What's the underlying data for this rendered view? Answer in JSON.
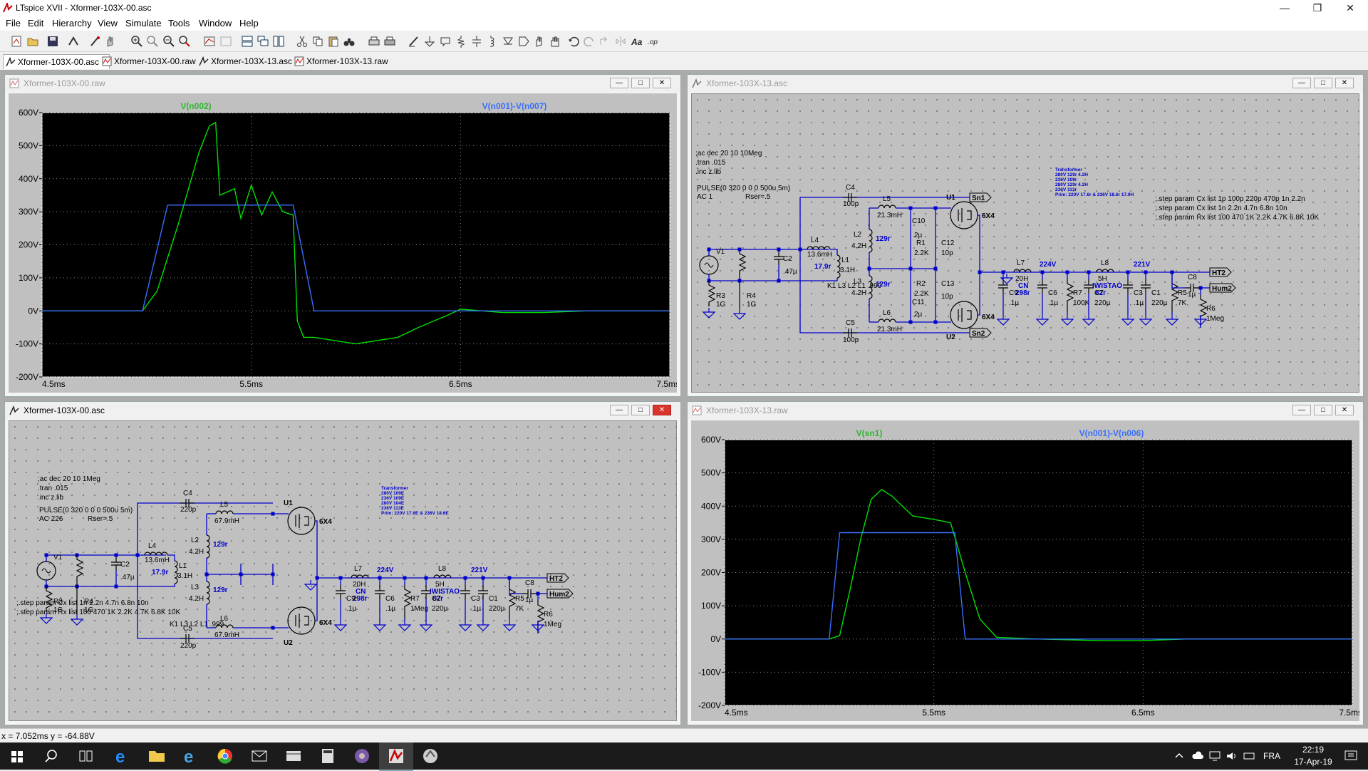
{
  "window": {
    "title": "LTspice XVII - Xformer-103X-00.asc"
  },
  "menu": [
    "File",
    "Edit",
    "Hierarchy",
    "View",
    "Simulate",
    "Tools",
    "Window",
    "Help"
  ],
  "tabs": [
    {
      "label": "Xformer-103X-00.asc",
      "active": true
    },
    {
      "label": "Xformer-103X-00.raw",
      "active": false
    },
    {
      "label": "Xformer-103X-13.asc",
      "active": false
    },
    {
      "label": "Xformer-103X-13.raw",
      "active": false
    }
  ],
  "windows": {
    "tl": {
      "title": "Xformer-103X-00.raw"
    },
    "tr": {
      "title": "Xformer-103X-13.asc"
    },
    "bl": {
      "title": "Xformer-103X-00.asc"
    },
    "br": {
      "title": "Xformer-103X-13.raw"
    }
  },
  "plot_tl": {
    "trace1": "V(n002)",
    "trace2": "V(n001)-V(n007)",
    "color1": "#00e000",
    "color2": "#3a6fff",
    "yticks": [
      "600V",
      "500V",
      "400V",
      "300V",
      "200V",
      "100V",
      "0V",
      "-100V",
      "-200V"
    ],
    "xticks": [
      "4.5ms",
      "5.5ms",
      "6.5ms",
      "7.5ms"
    ]
  },
  "plot_br": {
    "trace1": "V(sn1)",
    "trace2": "V(n001)-V(n006)",
    "yticks": [
      "600V",
      "500V",
      "400V",
      "300V",
      "200V",
      "100V",
      "0V",
      "-100V",
      "-200V"
    ],
    "xticks": [
      "4.5ms",
      "5.5ms",
      "6.5ms",
      "7.5ms"
    ]
  },
  "chart_data": [
    {
      "type": "line",
      "xlabel": "",
      "ylabel": "",
      "xlim": [
        4.5,
        7.5
      ],
      "ylim": [
        -200,
        600
      ],
      "x_unit": "ms",
      "y_unit": "V",
      "grid": true,
      "series": [
        {
          "name": "V(n002)",
          "x": [
            4.5,
            4.98,
            5.05,
            5.15,
            5.25,
            5.3,
            5.33,
            5.35,
            5.42,
            5.45,
            5.5,
            5.55,
            5.6,
            5.65,
            5.7,
            5.72,
            5.75,
            5.8,
            6.0,
            6.2,
            6.3,
            6.45,
            6.5,
            6.7,
            6.9,
            7.1,
            7.5
          ],
          "y": [
            0,
            0,
            60,
            260,
            480,
            560,
            570,
            350,
            370,
            280,
            380,
            290,
            360,
            300,
            290,
            -30,
            -80,
            -80,
            -100,
            -80,
            -50,
            -10,
            5,
            -5,
            -5,
            0,
            0
          ]
        },
        {
          "name": "V(n001)-V(n007)",
          "x": [
            4.5,
            4.98,
            5.1,
            5.7,
            5.8,
            7.5
          ],
          "y": [
            0,
            0,
            320,
            320,
            0,
            0
          ]
        }
      ]
    },
    {
      "type": "line",
      "xlabel": "",
      "ylabel": "",
      "xlim": [
        4.5,
        7.5
      ],
      "ylim": [
        -200,
        600
      ],
      "x_unit": "ms",
      "y_unit": "V",
      "grid": true,
      "series": [
        {
          "name": "V(sn1)",
          "x": [
            4.5,
            5.0,
            5.05,
            5.1,
            5.15,
            5.2,
            5.25,
            5.3,
            5.35,
            5.4,
            5.5,
            5.58,
            5.65,
            5.72,
            5.8,
            6.0,
            6.3,
            6.5,
            6.7,
            7.5
          ],
          "y": [
            0,
            0,
            10,
            150,
            300,
            420,
            450,
            430,
            400,
            370,
            360,
            350,
            200,
            60,
            5,
            0,
            -5,
            -5,
            0,
            0
          ]
        },
        {
          "name": "V(n001)-V(n006)",
          "x": [
            4.5,
            5.0,
            5.05,
            5.6,
            5.65,
            7.5
          ],
          "y": [
            0,
            0,
            320,
            320,
            0,
            0
          ]
        }
      ]
    }
  ],
  "sch_tr": {
    "directives": [
      ";ac dec 20 10 10Meg",
      ".tran .015",
      ".inc z.lib"
    ],
    "pulse": "PULSE(0 320 0 0 0 500u 5m)",
    "ac": "AC 1",
    "rser": "Rser=.5",
    "kline": "K1 L3 L2 L1 .999",
    "steps": [
      ";.step param Cx list 1p 100p 220p 470p 1n 2.2n",
      ";.step param Cx list 1n 2.2n 4.7n 6.8n 10n",
      ";.step param Rx list 100 470 1K 2.2K 4.7K 6.8K 10K"
    ],
    "transformer": [
      "Transformer",
      "280V 129r 4.2H",
      "236V 109r",
      "280V 129r 4.2H",
      "236V 113r",
      "Prim: 220V 17.6r & 236V 18.6r 17.9H"
    ],
    "labels": {
      "c4": "C4",
      "c4v": "100p",
      "l5": "L5",
      "l5v": "21.3mH",
      "sn1": "Sn1",
      "u1": "U1",
      "tube1": "6X4",
      "c10": "C10",
      "c10v": "2µ",
      "r1": "R1",
      "r1v": "2.2K",
      "c12": "C12",
      "c12v": "10p",
      "l2": "L2",
      "l2v": "4.2H",
      "l2r": "129r",
      "l4": "L4",
      "l4v": "13.6mH",
      "l4r": "17.9r",
      "l1": "L1",
      "l1v": "3.1H",
      "v1": "V1",
      "c2": "C2",
      "c2v": ".47µ",
      "r3": "R3",
      "r3v": "1G",
      "r4": "R4",
      "r4v": "1G",
      "l3": "L3",
      "l3v": "4.2H",
      "l3r": "129r",
      "r2": "R2",
      "r2v": "2.2K",
      "c13": "C13",
      "c13v": "10p",
      "c11": "C11",
      "c11v": "2µ",
      "l6": "L6",
      "l6v": "21.3mH",
      "c5": "C5",
      "c5v": "100p",
      "sn2": "Sn2",
      "u2": "U2",
      "tube2": "6X4",
      "l7": "L7",
      "l7v": "20H",
      "l7n": "CN",
      "l7r": "298r",
      "v224": "224V",
      "l8": "L8",
      "l8v": "5H",
      "l8n": "IWISTAO",
      "l8r": "82r",
      "v221": "221V",
      "ht2": "HT2",
      "hum2": "Hum2",
      "c9": "C9",
      "c9v": ".1µ",
      "c6": "C6",
      "c6v": ".1µ",
      "r7": "R7",
      "r7v": "100K",
      "c7": "C7",
      "c7v": "220µ",
      "c3": "C3",
      "c3v": ".1µ",
      "c1": "C1",
      "c1v": "220µ",
      "r5": "R5",
      "r5v": "7K",
      "c8": "C8",
      "c8v": "1µ",
      "r6": "R6",
      "r6v": "1Meg"
    }
  },
  "sch_bl": {
    "directives": [
      ";ac dec 20 10 1Meg",
      ".tran .015",
      ".inc z.lib"
    ],
    "pulse": "PULSE(0 320 0 0 0 500u 5m)",
    "ac": "AC 226",
    "rser": "Rser=.5",
    "kline": "K1 L3 L2 L1 .999",
    "steps": [
      ";.step param Cx list 1n 2.2n 4.7n 6.8n 10n",
      ";.step param Rx list 100 470 1K 2.2K 4.7K 6.8K 10K"
    ],
    "transformer": [
      "Transformer",
      "280V 109E",
      "236V 109E",
      "280V 104E",
      "236V 113E",
      "Prim: 220V 17.6E & 236V 18.6E"
    ],
    "labels": {
      "c4": "C4",
      "c4v": "220p",
      "l5": "L5",
      "l5v": "67.9mH",
      "u1": "U1",
      "tube1": "6X4",
      "l2": "L2",
      "l2v": "4.2H",
      "l2r": "129r",
      "l4": "L4",
      "l4v": "13.6mH",
      "l4r": "17.9r",
      "l1": "L1",
      "l1v": "3.1H",
      "v1": "V1",
      "c2": "C2",
      "c2v": ".47µ",
      "r3": "R3",
      "r3v": "1G",
      "r4": "R4",
      "r4v": "1G",
      "l3": "L3",
      "l3v": "4.2H",
      "l3r": "129r",
      "l6": "L6",
      "l6v": "67.9mH",
      "c5": "C5",
      "c5v": "220p",
      "u2": "U2",
      "tube2": "6X4",
      "l7": "L7",
      "l7v": "20H",
      "l7n": "CN",
      "l7r": "298r",
      "v224": "224V",
      "l8": "L8",
      "l8v": "5H",
      "l8n": "IWISTAO",
      "l8r": "82r",
      "v221": "221V",
      "ht2": "HT2",
      "hum2": "Hum2",
      "c9": "C9",
      "c9v": ".1µ",
      "c6": "C6",
      "c6v": ".1µ",
      "r7": "R7",
      "r7v": "1Meg",
      "c7": "C7",
      "c7v": "220µ",
      "c3": "C3",
      "c3v": ".1µ",
      "c1": "C1",
      "c1v": "220µ",
      "r5": "R5",
      "r5v": "7K",
      "c8": "C8",
      "c8v": "1µ",
      "r6": "R6",
      "r6v": "1Meg"
    }
  },
  "status": {
    "text": "x = 7.052ms    y = -64.88V"
  },
  "taskbar": {
    "lang": "FRA",
    "time": "22:19",
    "date": "17-Apr-19"
  }
}
